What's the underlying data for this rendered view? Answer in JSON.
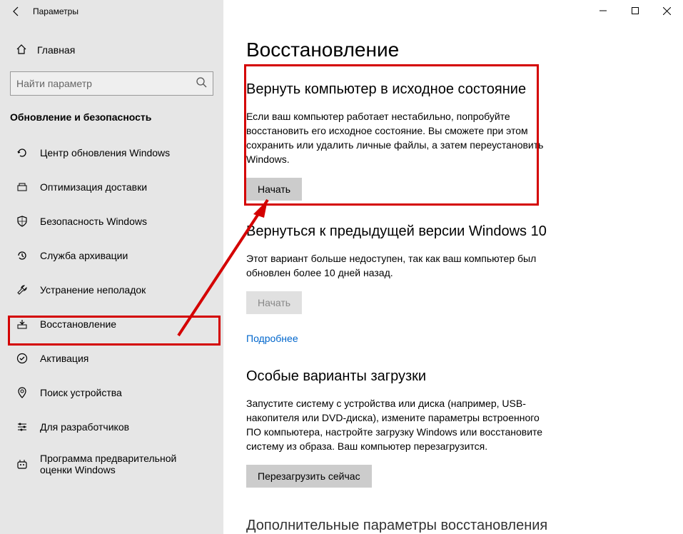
{
  "window": {
    "title": "Параметры"
  },
  "sidebar": {
    "home": "Главная",
    "search_placeholder": "Найти параметр",
    "category": "Обновление и безопасность",
    "items": [
      {
        "icon": "update-icon",
        "label": "Центр обновления Windows"
      },
      {
        "icon": "delivery-icon",
        "label": "Оптимизация доставки"
      },
      {
        "icon": "security-icon",
        "label": "Безопасность Windows"
      },
      {
        "icon": "backup-icon",
        "label": "Служба архивации"
      },
      {
        "icon": "troubleshoot-icon",
        "label": "Устранение неполадок"
      },
      {
        "icon": "recovery-icon",
        "label": "Восстановление"
      },
      {
        "icon": "activation-icon",
        "label": "Активация"
      },
      {
        "icon": "findmydevice-icon",
        "label": "Поиск устройства"
      },
      {
        "icon": "developer-icon",
        "label": "Для разработчиков"
      },
      {
        "icon": "insider-icon",
        "label": "Программа предварительной оценки Windows"
      }
    ]
  },
  "main": {
    "title": "Восстановление",
    "section1": {
      "heading": "Вернуть компьютер в исходное состояние",
      "text": "Если ваш компьютер работает нестабильно, попробуйте восстановить его исходное состояние. Вы сможете при этом сохранить или удалить личные файлы, а затем переустановить Windows.",
      "button": "Начать"
    },
    "section2": {
      "heading": "Вернуться к предыдущей версии Windows 10",
      "text": "Этот вариант больше недоступен, так как ваш компьютер был обновлен более 10 дней назад.",
      "button": "Начать",
      "link": "Подробнее"
    },
    "section3": {
      "heading": "Особые варианты загрузки",
      "text": "Запустите систему с устройства или диска (например, USB-накопителя или DVD-диска), измените параметры встроенного ПО компьютера, настройте загрузку Windows или восстановите систему из образа. Ваш компьютер перезагрузится.",
      "button": "Перезагрузить сейчас"
    },
    "truncated": "Дополнительные параметры восстановления"
  }
}
